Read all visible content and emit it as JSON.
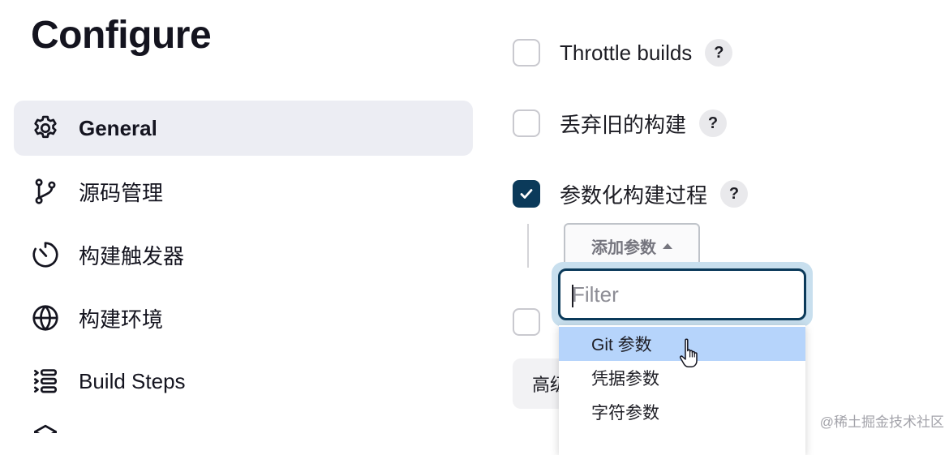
{
  "page_title": "Configure",
  "sidebar": {
    "items": [
      {
        "label": "General",
        "icon": "gear-icon",
        "active": true
      },
      {
        "label": "源码管理",
        "icon": "git-branch-icon",
        "active": false
      },
      {
        "label": "构建触发器",
        "icon": "timer-icon",
        "active": false
      },
      {
        "label": "构建环境",
        "icon": "globe-icon",
        "active": false
      },
      {
        "label": "Build Steps",
        "icon": "list-steps-icon",
        "active": false
      },
      {
        "label": "",
        "icon": "cube-icon",
        "active": false
      }
    ]
  },
  "options": {
    "throttle_builds": {
      "label": "Throttle builds",
      "checked": false,
      "help": "?"
    },
    "discard_old": {
      "label": "丢弃旧的构建",
      "checked": false,
      "help": "?"
    },
    "parameterized": {
      "label": "参数化构建过程",
      "checked": true,
      "help": "?"
    }
  },
  "add_param_button": {
    "label": "添加参数"
  },
  "advanced_button": {
    "label": "高级"
  },
  "dropdown": {
    "filter_placeholder": "Filter",
    "filter_value": "",
    "items": [
      {
        "label": "Git 参数",
        "highlighted": true
      },
      {
        "label": "凭据参数",
        "highlighted": false
      },
      {
        "label": "字符参数",
        "highlighted": false
      }
    ]
  },
  "watermark": "@稀土掘金技术社区",
  "colors": {
    "accent": "#0b3a5a",
    "active_bg": "#ecedf3",
    "highlight": "#b6d4fb",
    "focus_ring": "#c8dfee"
  }
}
